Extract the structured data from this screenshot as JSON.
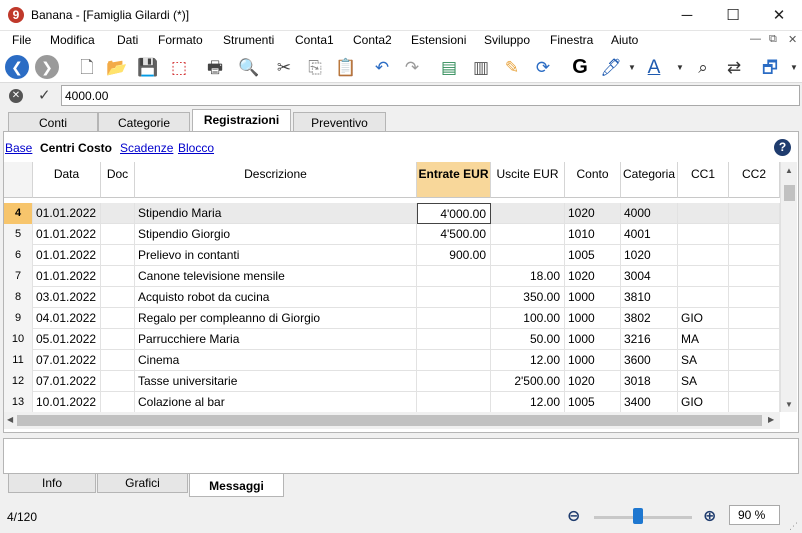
{
  "window": {
    "title": "Banana - [Famiglia Gilardi (*)]",
    "logo_text": "9",
    "minimize": "─",
    "maximize": "☐",
    "close": "✕"
  },
  "menu": {
    "items": [
      "File",
      "Modifica",
      "Dati",
      "Formato",
      "Strumenti",
      "Conta1",
      "Conta2",
      "Estensioni",
      "Sviluppo",
      "Finestra",
      "Aiuto"
    ],
    "mdi": {
      "minimize": "—",
      "restore": "⧉",
      "close": "✕"
    }
  },
  "toolbar": {
    "icons": [
      {
        "name": "back-icon",
        "glyph": "❮",
        "color": "#2b6cc4"
      },
      {
        "name": "forward-icon",
        "glyph": "❯",
        "color": "#9a9a9a"
      },
      {
        "name": "new-file-icon",
        "glyph": "🗋",
        "color": "#666666"
      },
      {
        "name": "open-folder-icon",
        "glyph": "📂",
        "color": "#e8a23a"
      },
      {
        "name": "save-icon",
        "glyph": "💾",
        "color": "#2b6cc4"
      },
      {
        "name": "pdf-icon",
        "glyph": "⬚",
        "color": "#d0282a"
      },
      {
        "name": "print-icon",
        "glyph": "🖶",
        "color": "#444444"
      },
      {
        "name": "print-preview-icon",
        "glyph": "🔍",
        "color": "#444444"
      },
      {
        "name": "cut-icon",
        "glyph": "✂",
        "color": "#444444"
      },
      {
        "name": "copy-icon",
        "glyph": "⎘",
        "color": "#888888"
      },
      {
        "name": "paste-icon",
        "glyph": "📋",
        "color": "#c9a26b"
      },
      {
        "name": "undo-icon",
        "glyph": "↶",
        "color": "#2b6cc4"
      },
      {
        "name": "redo-icon",
        "glyph": "↷",
        "color": "#9a9a9a"
      },
      {
        "name": "add-row-icon",
        "glyph": "▤",
        "color": "#2e8b57"
      },
      {
        "name": "delete-row-icon",
        "glyph": "▥",
        "color": "#555555"
      },
      {
        "name": "rename-columns-icon",
        "glyph": "✎",
        "color": "#e8a23a"
      },
      {
        "name": "recheck-icon",
        "glyph": "⟳",
        "color": "#2b6cc4"
      },
      {
        "name": "bold-icon",
        "glyph": "G",
        "color": "#000000"
      },
      {
        "name": "highlight-icon",
        "glyph": "🖊",
        "color": "#1e5ab0"
      },
      {
        "name": "font-color-icon",
        "glyph": "A",
        "color": "#1e5ab0"
      },
      {
        "name": "find-icon",
        "glyph": "⌕",
        "color": "#333333"
      },
      {
        "name": "find-replace-icon",
        "glyph": "⇄",
        "color": "#333333"
      },
      {
        "name": "window-icon",
        "glyph": "🗗",
        "color": "#2b6cc4"
      }
    ]
  },
  "editbar": {
    "cancel_glyph": "✕",
    "confirm_glyph": "✓",
    "value": "4000.00"
  },
  "tabs": [
    "Conti",
    "Categorie",
    "Registrazioni",
    "Preventivo"
  ],
  "views": {
    "items": [
      "Base",
      "Centri Costo",
      "Scadenze",
      "Blocco"
    ],
    "current": "Centri Costo"
  },
  "help_glyph": "?",
  "table": {
    "columns": [
      "Data",
      "Doc",
      "Descrizione",
      "Entrate EUR",
      "Uscite EUR",
      "Conto",
      "Categoria",
      "CC1",
      "CC2"
    ],
    "highlighted_column": "Entrate EUR",
    "selected_row": 4,
    "rows": [
      {
        "n": "4",
        "data": "01.01.2022",
        "doc": "",
        "descr": "Stipendio Maria",
        "entrate": "4'000.00",
        "uscite": "",
        "conto": "1020",
        "categoria": "4000",
        "cc1": "",
        "cc2": ""
      },
      {
        "n": "5",
        "data": "01.01.2022",
        "doc": "",
        "descr": "Stipendio Giorgio",
        "entrate": "4'500.00",
        "uscite": "",
        "conto": "1010",
        "categoria": "4001",
        "cc1": "",
        "cc2": ""
      },
      {
        "n": "6",
        "data": "01.01.2022",
        "doc": "",
        "descr": "Prelievo in contanti",
        "entrate": "900.00",
        "uscite": "",
        "conto": "1005",
        "categoria": "1020",
        "cc1": "",
        "cc2": ""
      },
      {
        "n": "7",
        "data": "01.01.2022",
        "doc": "",
        "descr": "Canone televisione mensile",
        "entrate": "",
        "uscite": "18.00",
        "conto": "1020",
        "categoria": "3004",
        "cc1": "",
        "cc2": ""
      },
      {
        "n": "8",
        "data": "03.01.2022",
        "doc": "",
        "descr": "Acquisto robot da cucina",
        "entrate": "",
        "uscite": "350.00",
        "conto": "1000",
        "categoria": "3810",
        "cc1": "",
        "cc2": ""
      },
      {
        "n": "9",
        "data": "04.01.2022",
        "doc": "",
        "descr": "Regalo per compleanno di Giorgio",
        "entrate": "",
        "uscite": "100.00",
        "conto": "1000",
        "categoria": "3802",
        "cc1": "GIO",
        "cc2": ""
      },
      {
        "n": "10",
        "data": "05.01.2022",
        "doc": "",
        "descr": "Parrucchiere Maria",
        "entrate": "",
        "uscite": "50.00",
        "conto": "1000",
        "categoria": "3216",
        "cc1": "MA",
        "cc2": ""
      },
      {
        "n": "11",
        "data": "07.01.2022",
        "doc": "",
        "descr": "Cinema",
        "entrate": "",
        "uscite": "12.00",
        "conto": "1000",
        "categoria": "3600",
        "cc1": "SA",
        "cc2": ""
      },
      {
        "n": "12",
        "data": "07.01.2022",
        "doc": "",
        "descr": "Tasse universitarie",
        "entrate": "",
        "uscite": "2'500.00",
        "conto": "1020",
        "categoria": "3018",
        "cc1": "SA",
        "cc2": ""
      },
      {
        "n": "13",
        "data": "10.01.2022",
        "doc": "",
        "descr": "Colazione al bar",
        "entrate": "",
        "uscite": "12.00",
        "conto": "1005",
        "categoria": "3400",
        "cc1": "GIO",
        "cc2": ""
      }
    ]
  },
  "bottom_tabs": [
    "Info",
    "Grafici",
    "Messaggi"
  ],
  "bottom_active": "Messaggi",
  "status": {
    "position": "4/120",
    "zoom": "90 %",
    "zoom_fraction": 0.45
  },
  "colors": {
    "highlight_header": "#f8d79a",
    "selected_rownum": "#f7c56c",
    "link": "#0000cc",
    "accent": "#1e77d0"
  }
}
